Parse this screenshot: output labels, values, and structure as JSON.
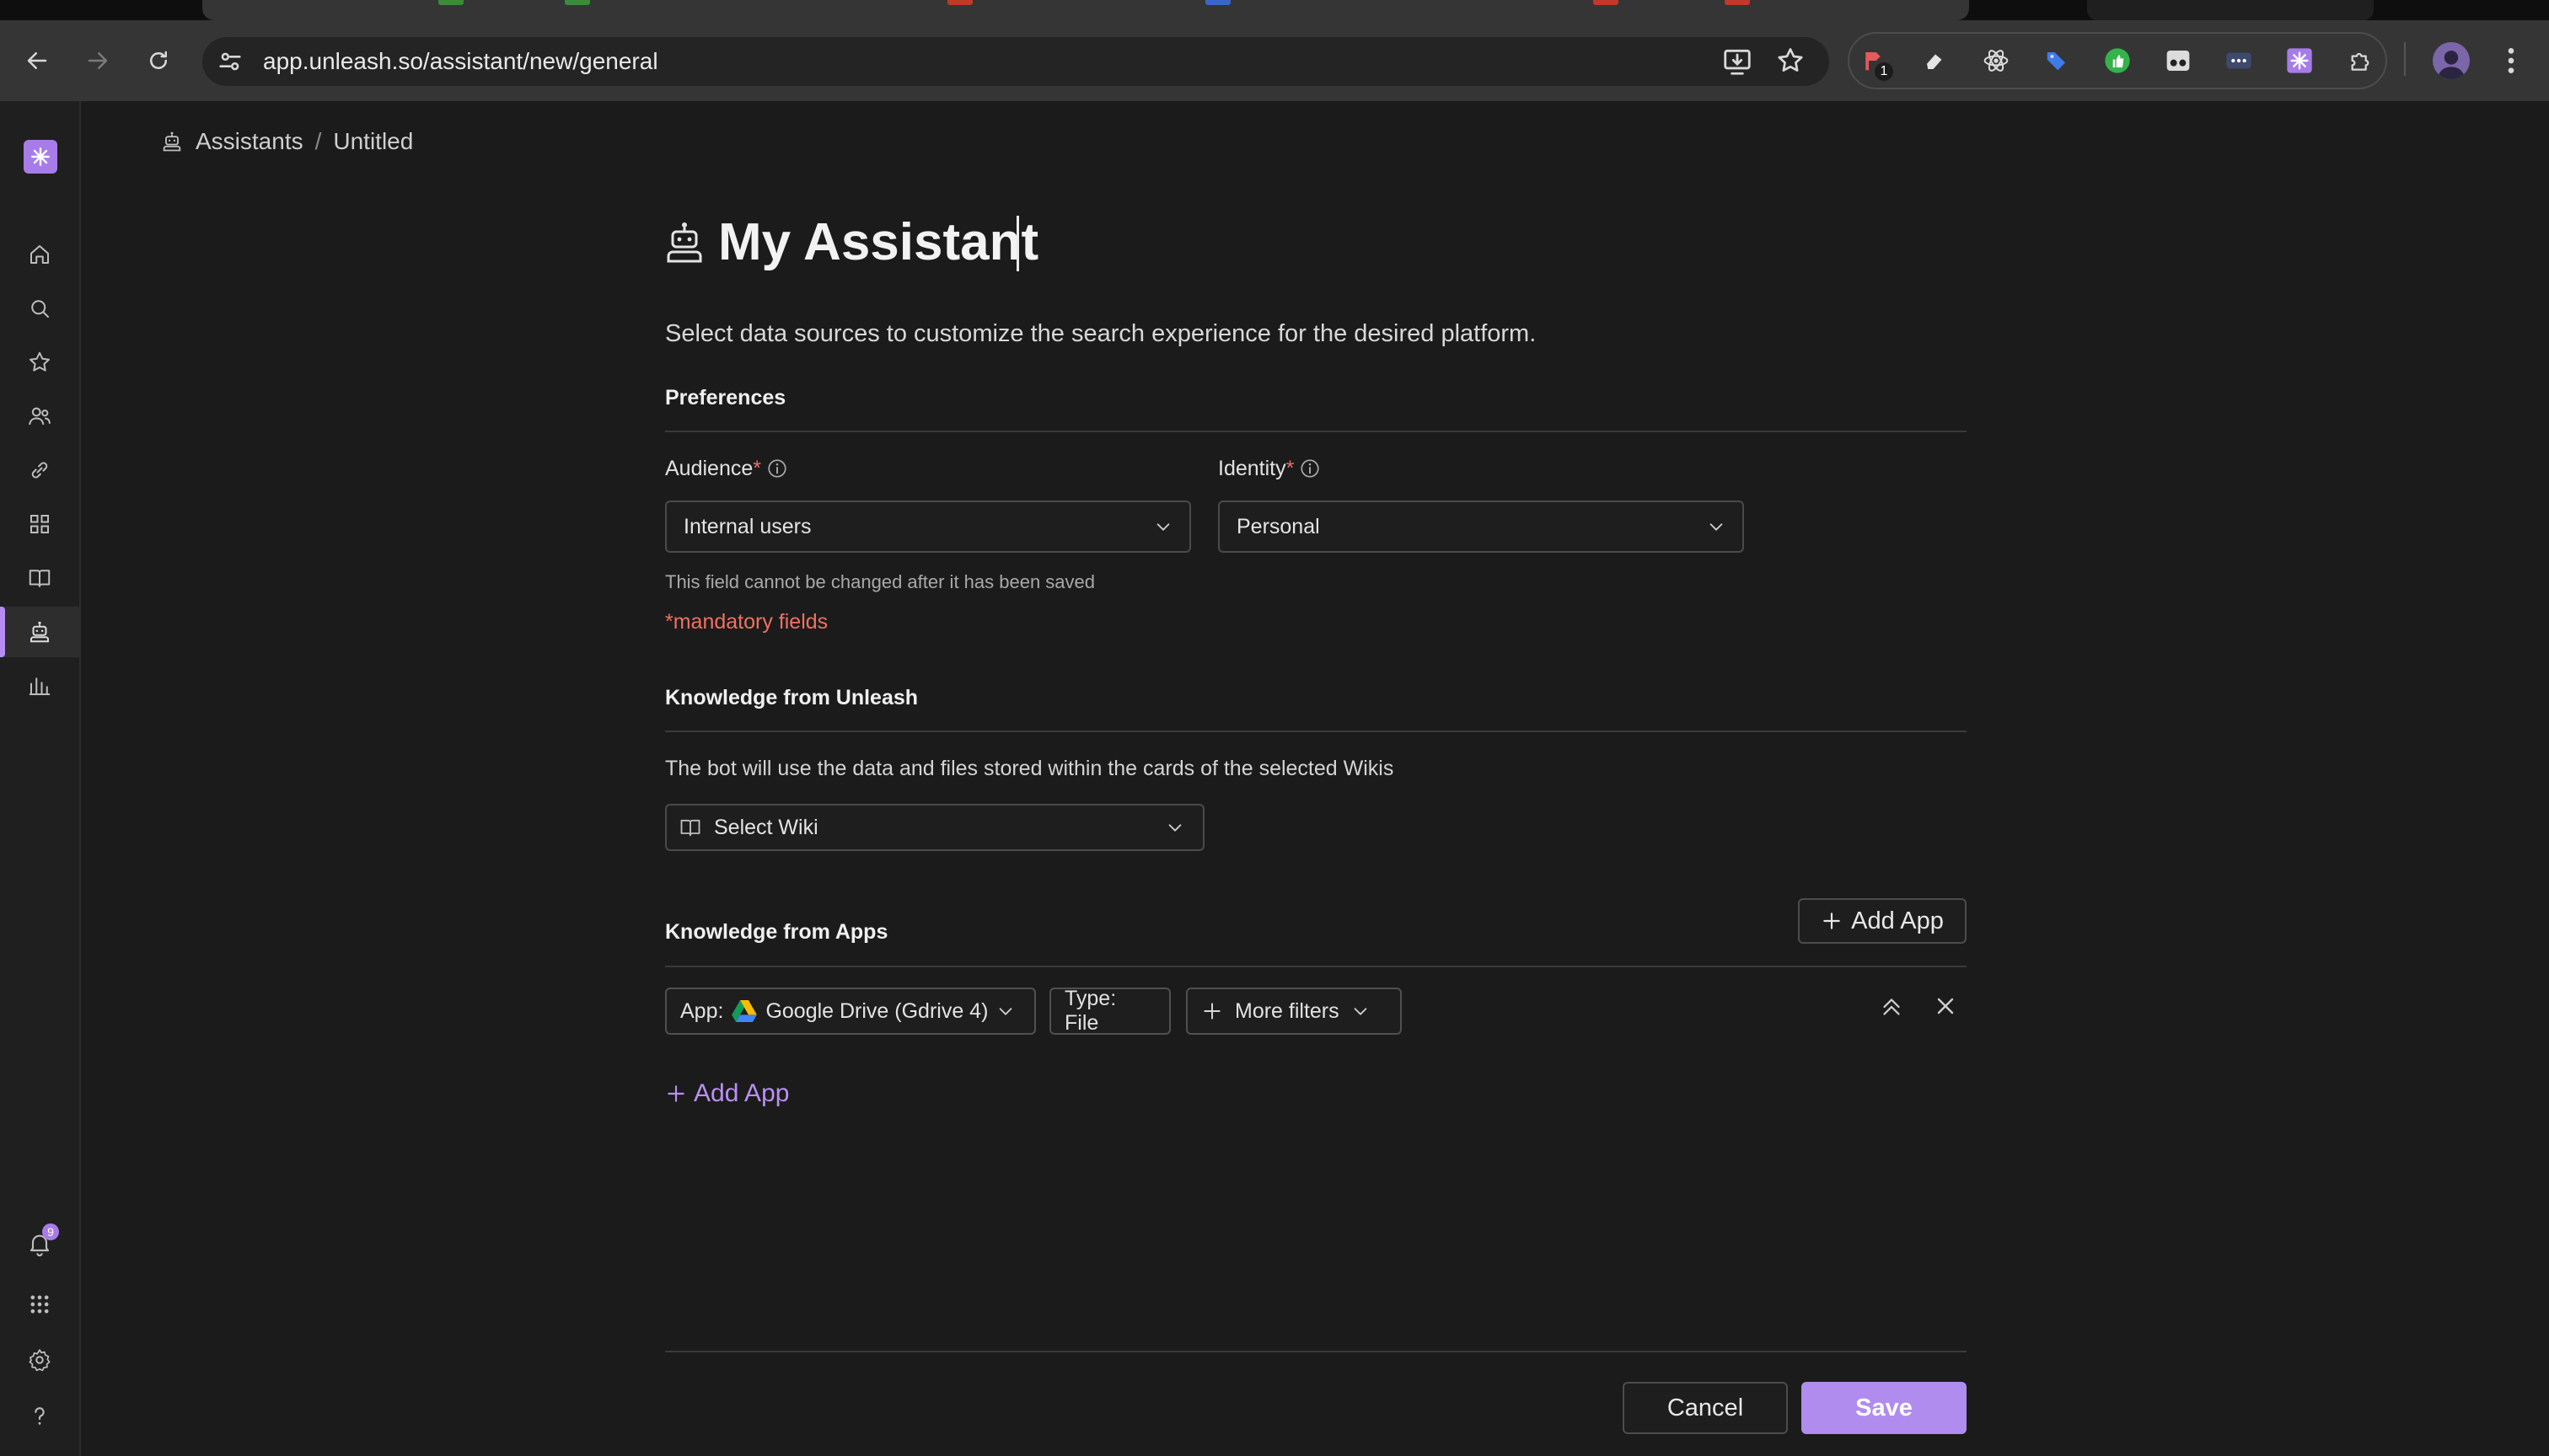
{
  "browser": {
    "url": "app.unleash.so/assistant/new/general",
    "extension_badge": "1"
  },
  "sidebar": {
    "items": [
      {
        "name": "home",
        "icon": "home-icon"
      },
      {
        "name": "search",
        "icon": "search-icon"
      },
      {
        "name": "favorites",
        "icon": "star-icon"
      },
      {
        "name": "people",
        "icon": "people-icon"
      },
      {
        "name": "links",
        "icon": "link-icon"
      },
      {
        "name": "apps",
        "icon": "grid-icon"
      },
      {
        "name": "wikis",
        "icon": "book-icon"
      },
      {
        "name": "assistants",
        "icon": "robot-icon",
        "active": true
      },
      {
        "name": "analytics",
        "icon": "bar-chart-icon"
      }
    ],
    "notification_count": "9"
  },
  "breadcrumb": {
    "parent": "Assistants",
    "separator": "/",
    "current": "Untitled"
  },
  "page": {
    "title": "My Assistant",
    "subtitle": "Select data sources to customize the search experience for the desired platform."
  },
  "preferences": {
    "heading": "Preferences",
    "audience": {
      "label": "Audience",
      "required_mark": "*",
      "value": "Internal users",
      "hint": "This field cannot be changed after it has been saved"
    },
    "identity": {
      "label": "Identity",
      "required_mark": "*",
      "value": "Personal"
    },
    "mandatory_note": "*mandatory fields"
  },
  "knowledge_unleash": {
    "heading": "Knowledge from Unleash",
    "description": "The bot will use the data and files stored within the cards of the selected Wikis",
    "select_placeholder": "Select Wiki"
  },
  "knowledge_apps": {
    "heading": "Knowledge from Apps",
    "add_app_button": "Add App",
    "filters": {
      "app_prefix": "App:",
      "app_value": "Google Drive (Gdrive 4)",
      "type": "Type: File",
      "more": "More filters"
    },
    "add_app_link": "Add App"
  },
  "footer": {
    "cancel": "Cancel",
    "save": "Save"
  },
  "colors": {
    "accent": "#b08cee",
    "background": "#1b1b1b",
    "required": "#f06a6a"
  }
}
